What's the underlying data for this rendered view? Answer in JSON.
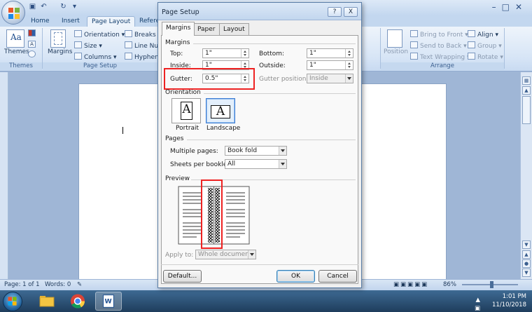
{
  "ribbon": {
    "tabs": [
      "Home",
      "Insert",
      "Page Layout",
      "Refere"
    ],
    "active_tab": "Page Layout",
    "themes": {
      "button_label": "Themes",
      "group_label": "Themes"
    },
    "page_setup": {
      "margins_label": "Margins",
      "orientation_label": "Orientation",
      "size_label": "Size",
      "columns_label": "Columns",
      "breaks_label": "Breaks",
      "line_numbers_label": "Line Num",
      "hyphenation_label": "Hyphena",
      "group_label": "Page Setup"
    },
    "arrange": {
      "position_label": "Position",
      "bring_to_front_label": "Bring to Front",
      "send_to_back_label": "Send to Back",
      "text_wrapping_label": "Text Wrapping",
      "align_label": "Align",
      "group_btn_label": "Group",
      "rotate_label": "Rotate",
      "group_label": "Arrange"
    }
  },
  "dialog": {
    "title": "Page Setup",
    "help_button": "?",
    "close_button": "X",
    "tabs": [
      "Margins",
      "Paper",
      "Layout"
    ],
    "active_tab": "Margins",
    "margins": {
      "section_label": "Margins",
      "top": {
        "label": "Top:",
        "value": "1\""
      },
      "bottom": {
        "label": "Bottom:",
        "value": "1\""
      },
      "inside": {
        "label": "Inside:",
        "value": "1\""
      },
      "outside": {
        "label": "Outside:",
        "value": "1\""
      },
      "gutter": {
        "label": "Gutter:",
        "value": "0.5\""
      },
      "gutter_position": {
        "label": "Gutter position:",
        "value": "Inside"
      }
    },
    "orientation": {
      "section_label": "Orientation",
      "portrait_label": "Portrait",
      "landscape_label": "Landscape",
      "selected": "Landscape"
    },
    "pages": {
      "section_label": "Pages",
      "multiple_pages": {
        "label": "Multiple pages:",
        "value": "Book fold"
      },
      "sheets_per_booklet": {
        "label": "Sheets per booklet:",
        "value": "All"
      }
    },
    "preview": {
      "section_label": "Preview",
      "apply_to": {
        "label": "Apply to:",
        "value": "Whole document"
      }
    },
    "buttons": {
      "default": "Default...",
      "ok": "OK",
      "cancel": "Cancel"
    }
  },
  "statusbar": {
    "page": "Page: 1 of 1",
    "words": "Words: 0",
    "zoom": "86%"
  },
  "tray": {
    "time": "1:01 PM",
    "date": "11/10/2018"
  },
  "colors": {
    "highlight_box": "#ee2222",
    "ribbon_bg": "#d7e5f6",
    "dialog_bg": "#f0f0f0",
    "taskbar": "#2b4f73"
  }
}
